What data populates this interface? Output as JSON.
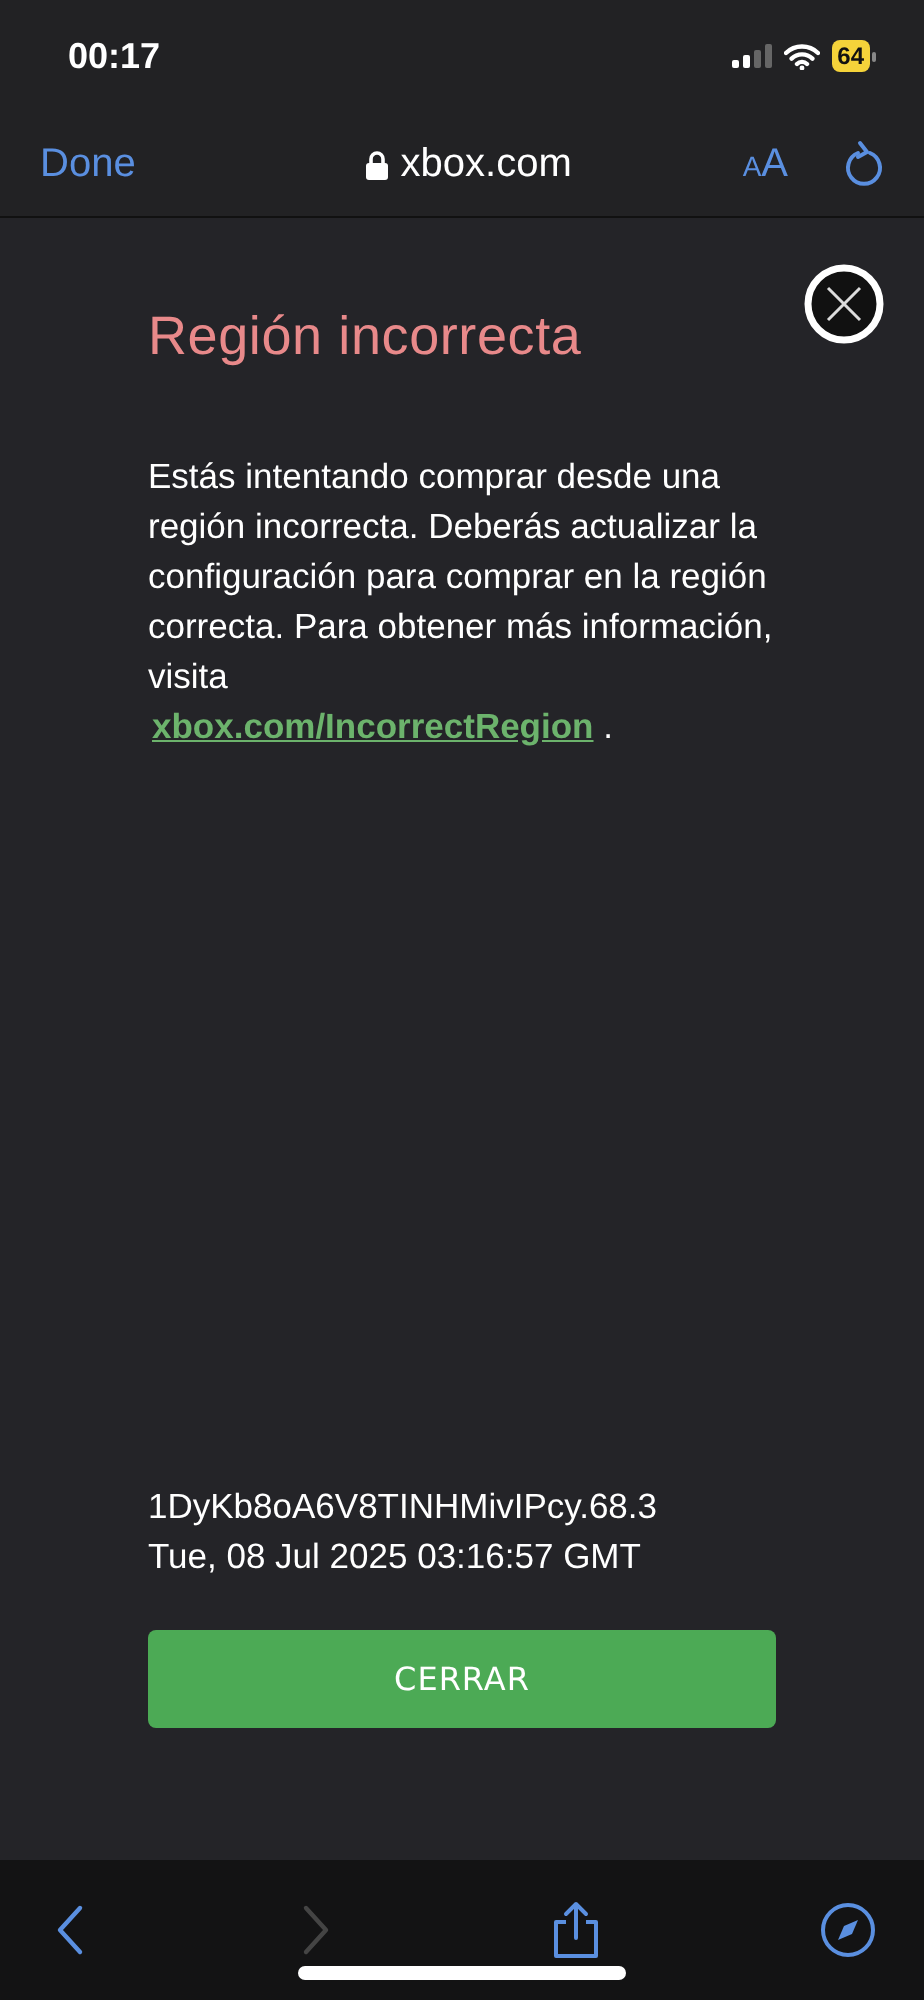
{
  "status_bar": {
    "time": "00:17",
    "battery": "64"
  },
  "nav_bar": {
    "done": "Done",
    "url": "xbox.com",
    "text_size": "AA"
  },
  "dialog": {
    "title": "Región incorrecta",
    "body": "Estás intentando comprar desde una región incorrecta. Deberás actualizar la configuración para comprar en la región correcta. Para obtener más información, visita",
    "link": "xbox.com/IncorrectRegion",
    "after_link": ".",
    "reference": "1DyKb8oA6V8TINHMivIPcy.68.3",
    "timestamp": "Tue, 08 Jul 2025 03:16:57 GMT",
    "button": "CERRAR"
  },
  "toolbar": {
    "back_disabled": false,
    "forward_disabled": true
  }
}
